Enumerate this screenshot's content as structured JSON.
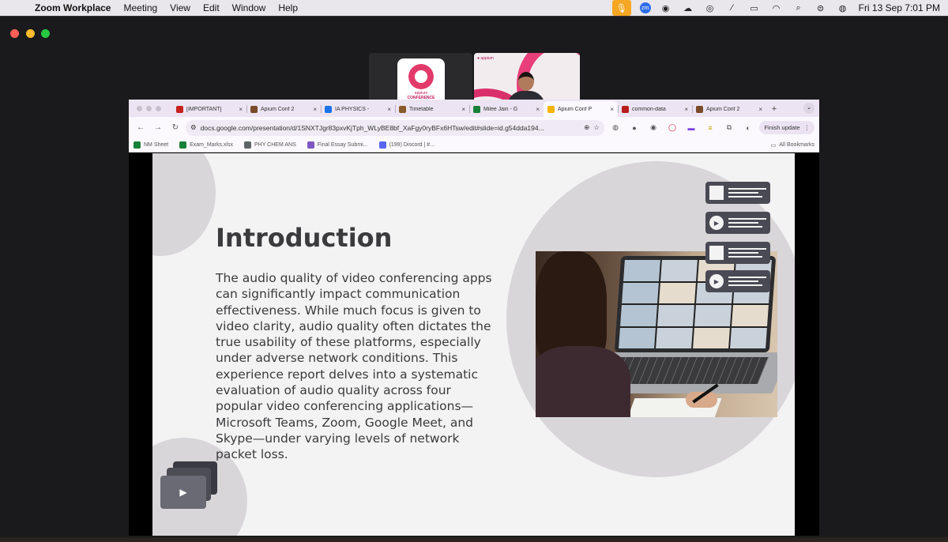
{
  "menubar": {
    "app_name": "Zoom Workplace",
    "menus": [
      "Meeting",
      "View",
      "Edit",
      "Window",
      "Help"
    ],
    "zoom_badge": "zm",
    "clock": "Fri 13 Sep  7:01 PM"
  },
  "tabs": [
    {
      "label": "[IMPORTANT]",
      "favicon_color": "#c5221f"
    },
    {
      "label": "Apium Conf 2",
      "favicon_color": "#7a4b2a"
    },
    {
      "label": "IA PHYSICS -",
      "favicon_color": "#1a73e8"
    },
    {
      "label": "Timetable",
      "favicon_color": "#8b5a2b"
    },
    {
      "label": "Milee Jain - G",
      "favicon_color": "#188038"
    },
    {
      "label": "Apium Conf P",
      "favicon_color": "#f4b400"
    },
    {
      "label": "common-data",
      "favicon_color": "#b71c1c"
    },
    {
      "label": "Apium Conf 2",
      "favicon_color": "#7a4b2a"
    }
  ],
  "tab_close": "×",
  "new_tab": "+",
  "omnibox": {
    "url": "docs.google.com/presentation/d/1SNXTJgr83pxvKjTph_WLyBE8bf_XaFgy0ryBFx6HTsw/edit#slide=id.g54dda194..."
  },
  "finish_update": "Finish update",
  "bookmarks": [
    {
      "label": "NM Sheet",
      "color": "#188038"
    },
    {
      "label": "Exam_Marks.xlsx",
      "color": "#188038"
    },
    {
      "label": "PHY CHEM ANS",
      "color": "#5f6368"
    },
    {
      "label": "Final Essay Submi...",
      "color": "#7e57c2"
    },
    {
      "label": "(199) Discord | #...",
      "color": "#5865f2"
    }
  ],
  "all_bookmarks": "All Bookmarks",
  "slide": {
    "title": "Introduction",
    "body": "The audio quality of video conferencing apps can significantly impact communication effectiveness. While much focus is given to video clarity, audio quality often dictates the true usability of these platforms, especially under adverse network conditions. This experience report delves into a systematic evaluation of audio quality across four popular video conferencing applications—Microsoft Teams, Zoom, Google Meet, and Skype—under varying levels of network packet loss."
  },
  "thumb_logo": {
    "line1": "appium",
    "line2": "CONFERENCE"
  },
  "colors": {
    "zoom_bg": "#1a1a1c",
    "slide_bg": "#f4f3f4",
    "accent_pink": "#e23a6b",
    "mic_orange": "#f5a623"
  },
  "icons": [
    "apple-icon",
    "microphone-icon",
    "wifi-icon",
    "search-icon",
    "battery-icon",
    "star-icon",
    "play-icon",
    "folder-icon"
  ]
}
